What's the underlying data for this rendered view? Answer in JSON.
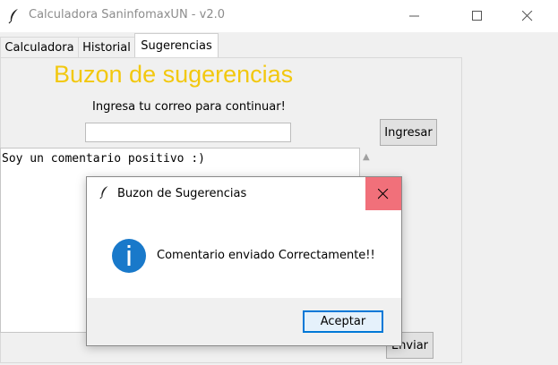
{
  "window": {
    "title": "Calculadora SaninfomaxUN - v2.0",
    "icon": "feather-icon"
  },
  "tabs": [
    {
      "label": "Calculadora"
    },
    {
      "label": "Historial"
    },
    {
      "label": "Sugerencias"
    }
  ],
  "main": {
    "heading": "Buzon de sugerencias",
    "prompt": "Ingresa tu correo para continuar!",
    "email_value": "",
    "ingresar_label": "Ingresar",
    "comment_text": "Soy un comentario positivo :)",
    "enviar_label": "Enviar"
  },
  "dialog": {
    "title": "Buzon de Sugerencias",
    "message": "Comentario enviado Correctamente!!",
    "ok_label": "Aceptar",
    "icon": "info-icon"
  },
  "colors": {
    "heading": "#f2c80f",
    "close_hover": "#f1707a",
    "info": "#1979ca",
    "accent": "#0078d7"
  }
}
